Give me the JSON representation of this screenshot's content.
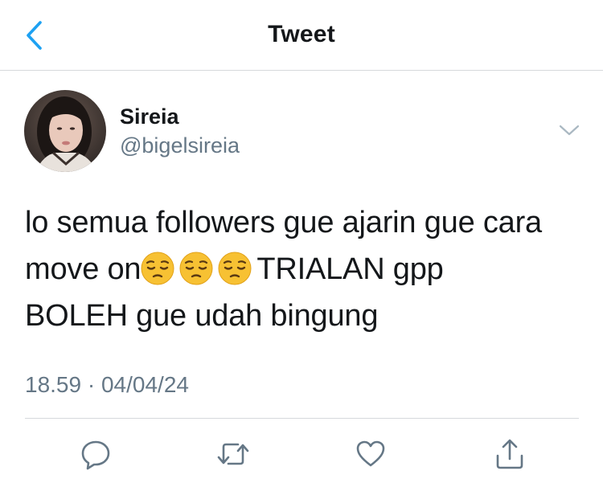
{
  "header": {
    "title": "Tweet",
    "back_icon": "chevron-left-icon",
    "accent_color": "#1da1f2"
  },
  "tweet": {
    "author": {
      "display_name": "Sireia",
      "handle": "@bigelsireia",
      "avatar": "profile-photo"
    },
    "text_lines": [
      "lo semua followers gue ajarin gue cara",
      "move on",
      "TRIALAN gpp",
      "BOLEH gue udah bingung"
    ],
    "emoji": "pensive-face",
    "emoji_count": 3,
    "time": "18.59",
    "separator": "·",
    "date": "04/04/24"
  },
  "actions": [
    {
      "icon": "reply-icon"
    },
    {
      "icon": "retweet-icon"
    },
    {
      "icon": "like-icon"
    },
    {
      "icon": "share-icon"
    }
  ]
}
